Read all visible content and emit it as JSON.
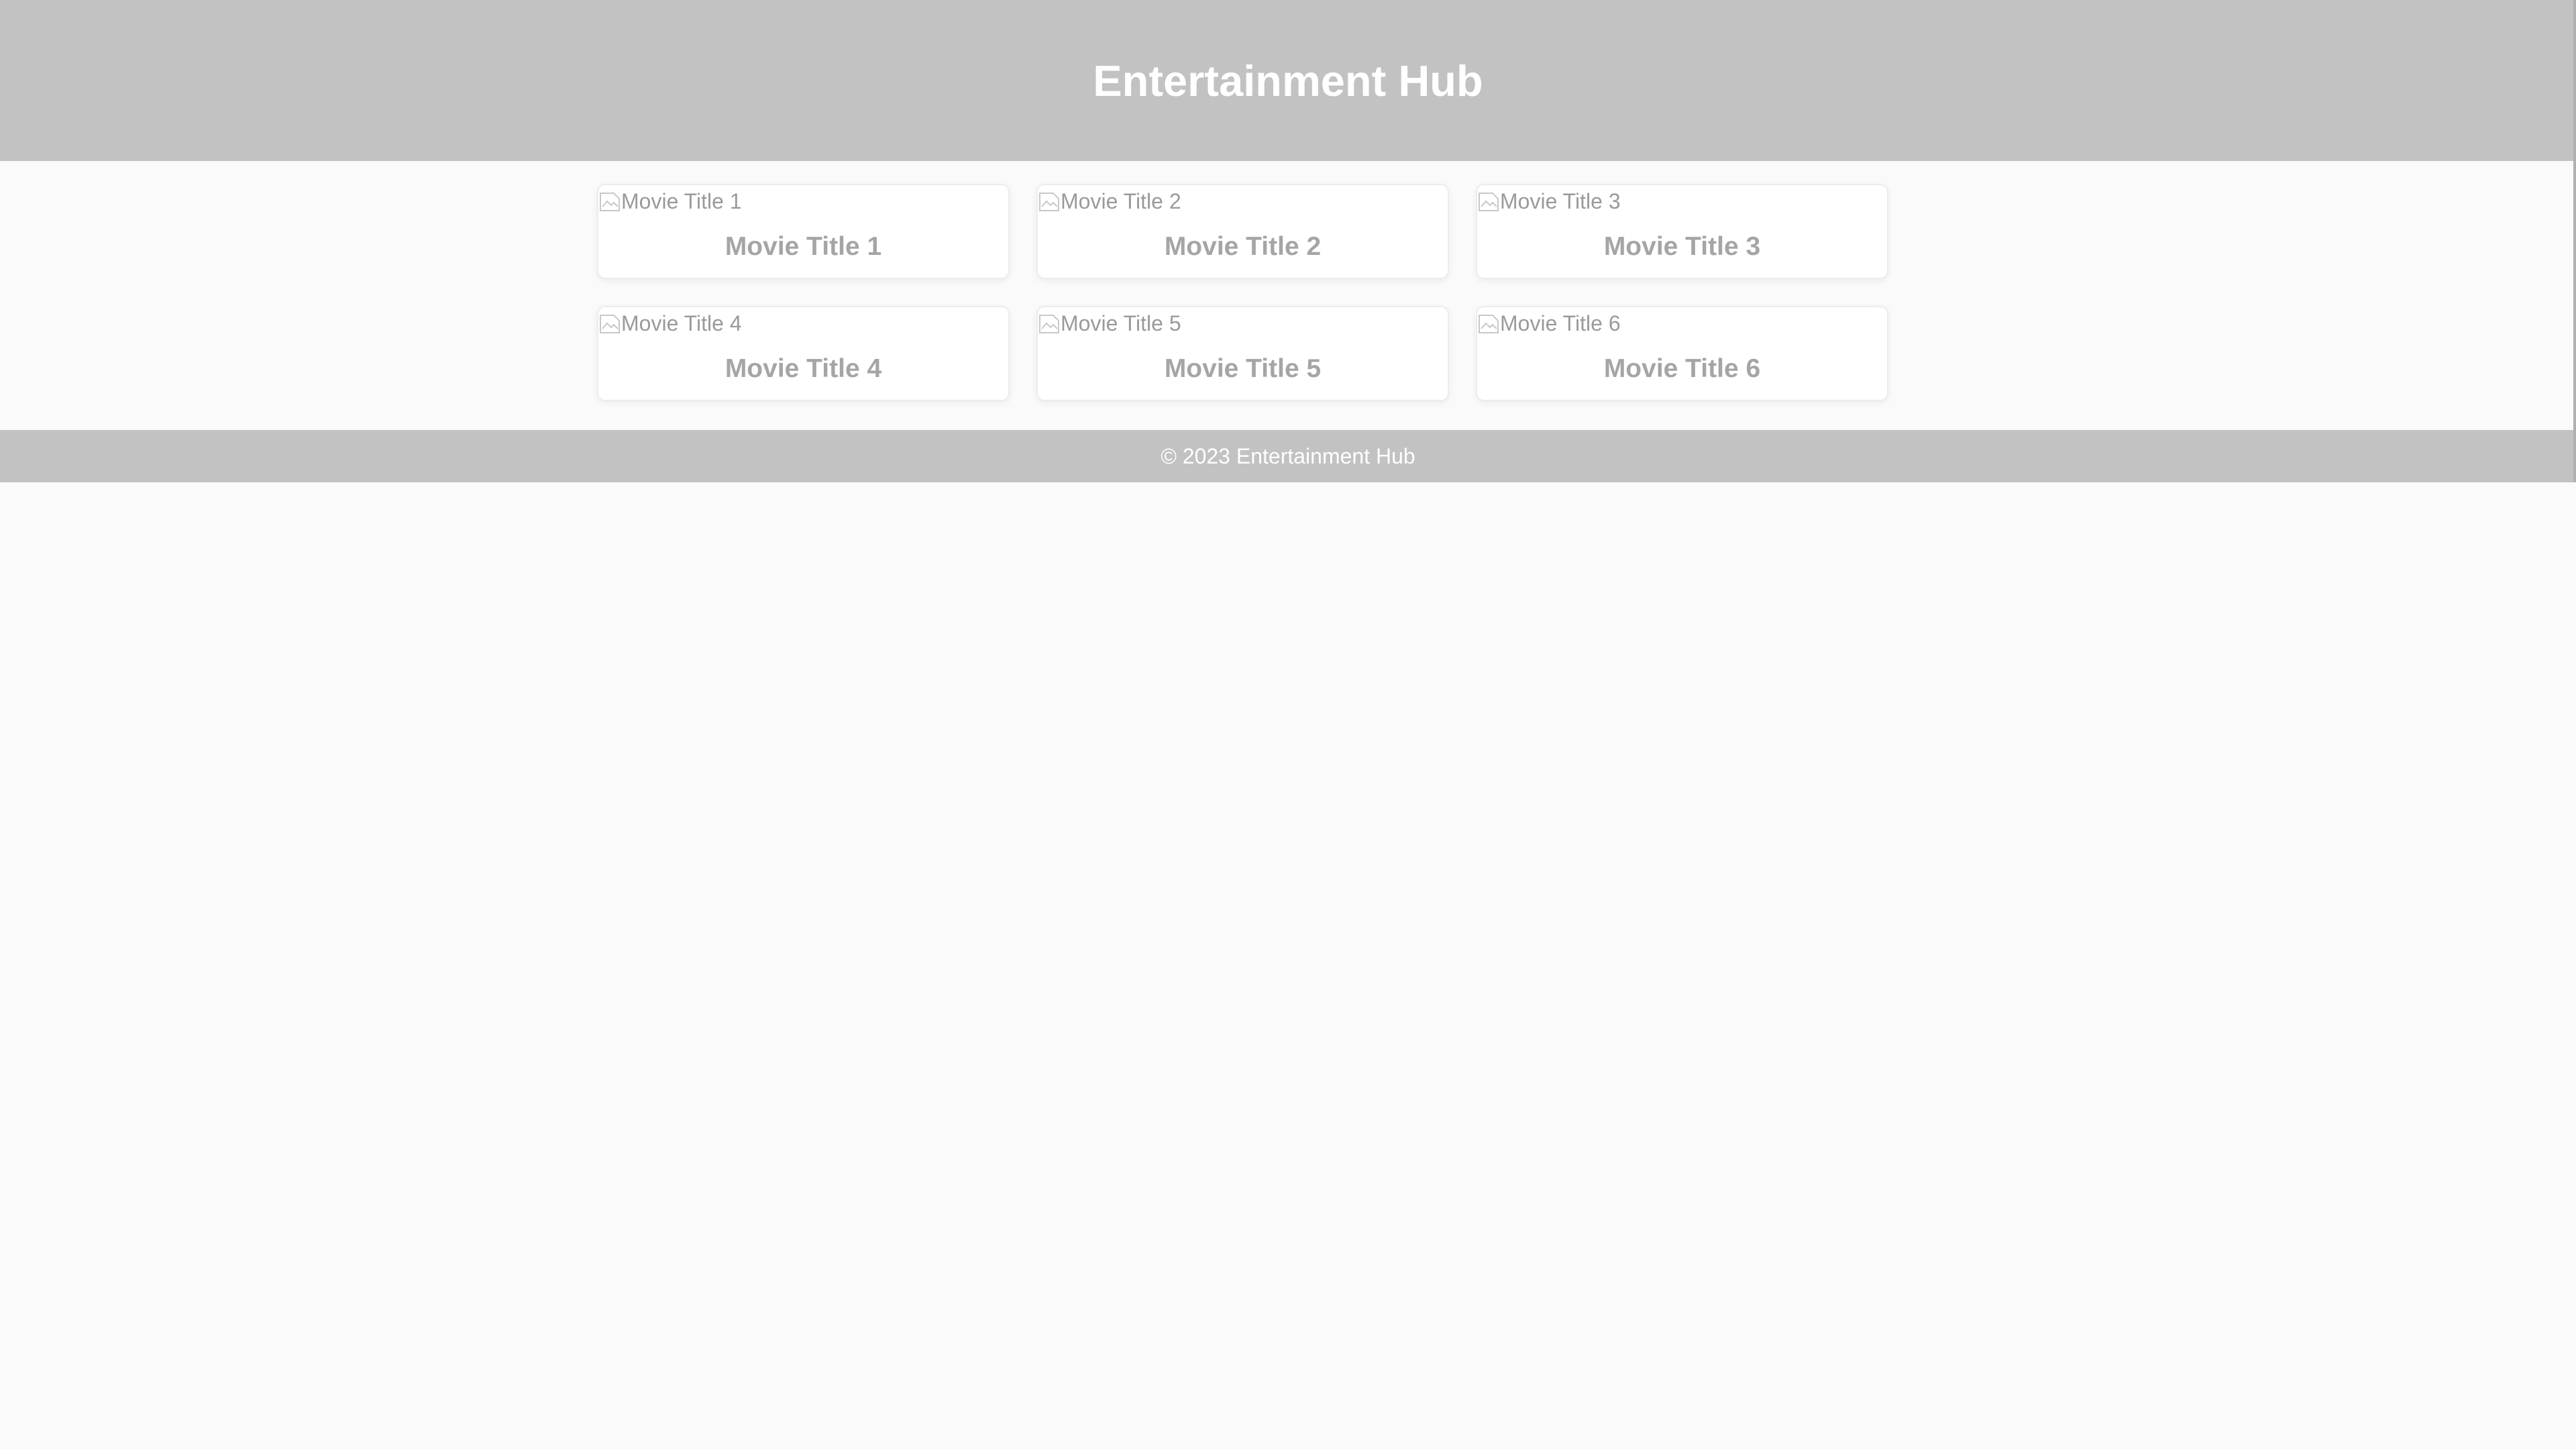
{
  "header": {
    "title": "Entertainment Hub"
  },
  "movies": [
    {
      "alt": "Movie Title 1",
      "title": "Movie Title 1"
    },
    {
      "alt": "Movie Title 2",
      "title": "Movie Title 2"
    },
    {
      "alt": "Movie Title 3",
      "title": "Movie Title 3"
    },
    {
      "alt": "Movie Title 4",
      "title": "Movie Title 4"
    },
    {
      "alt": "Movie Title 5",
      "title": "Movie Title 5"
    },
    {
      "alt": "Movie Title 6",
      "title": "Movie Title 6"
    }
  ],
  "footer": {
    "text": "© 2023 Entertainment Hub"
  },
  "icons": {
    "poster": "broken-image-icon"
  },
  "colors": {
    "header_bg": "#c2c2c2",
    "page_bg": "#fafafa",
    "card_bg": "#ffffff",
    "title_text": "#a5a5a5",
    "header_text": "#ffffff"
  }
}
